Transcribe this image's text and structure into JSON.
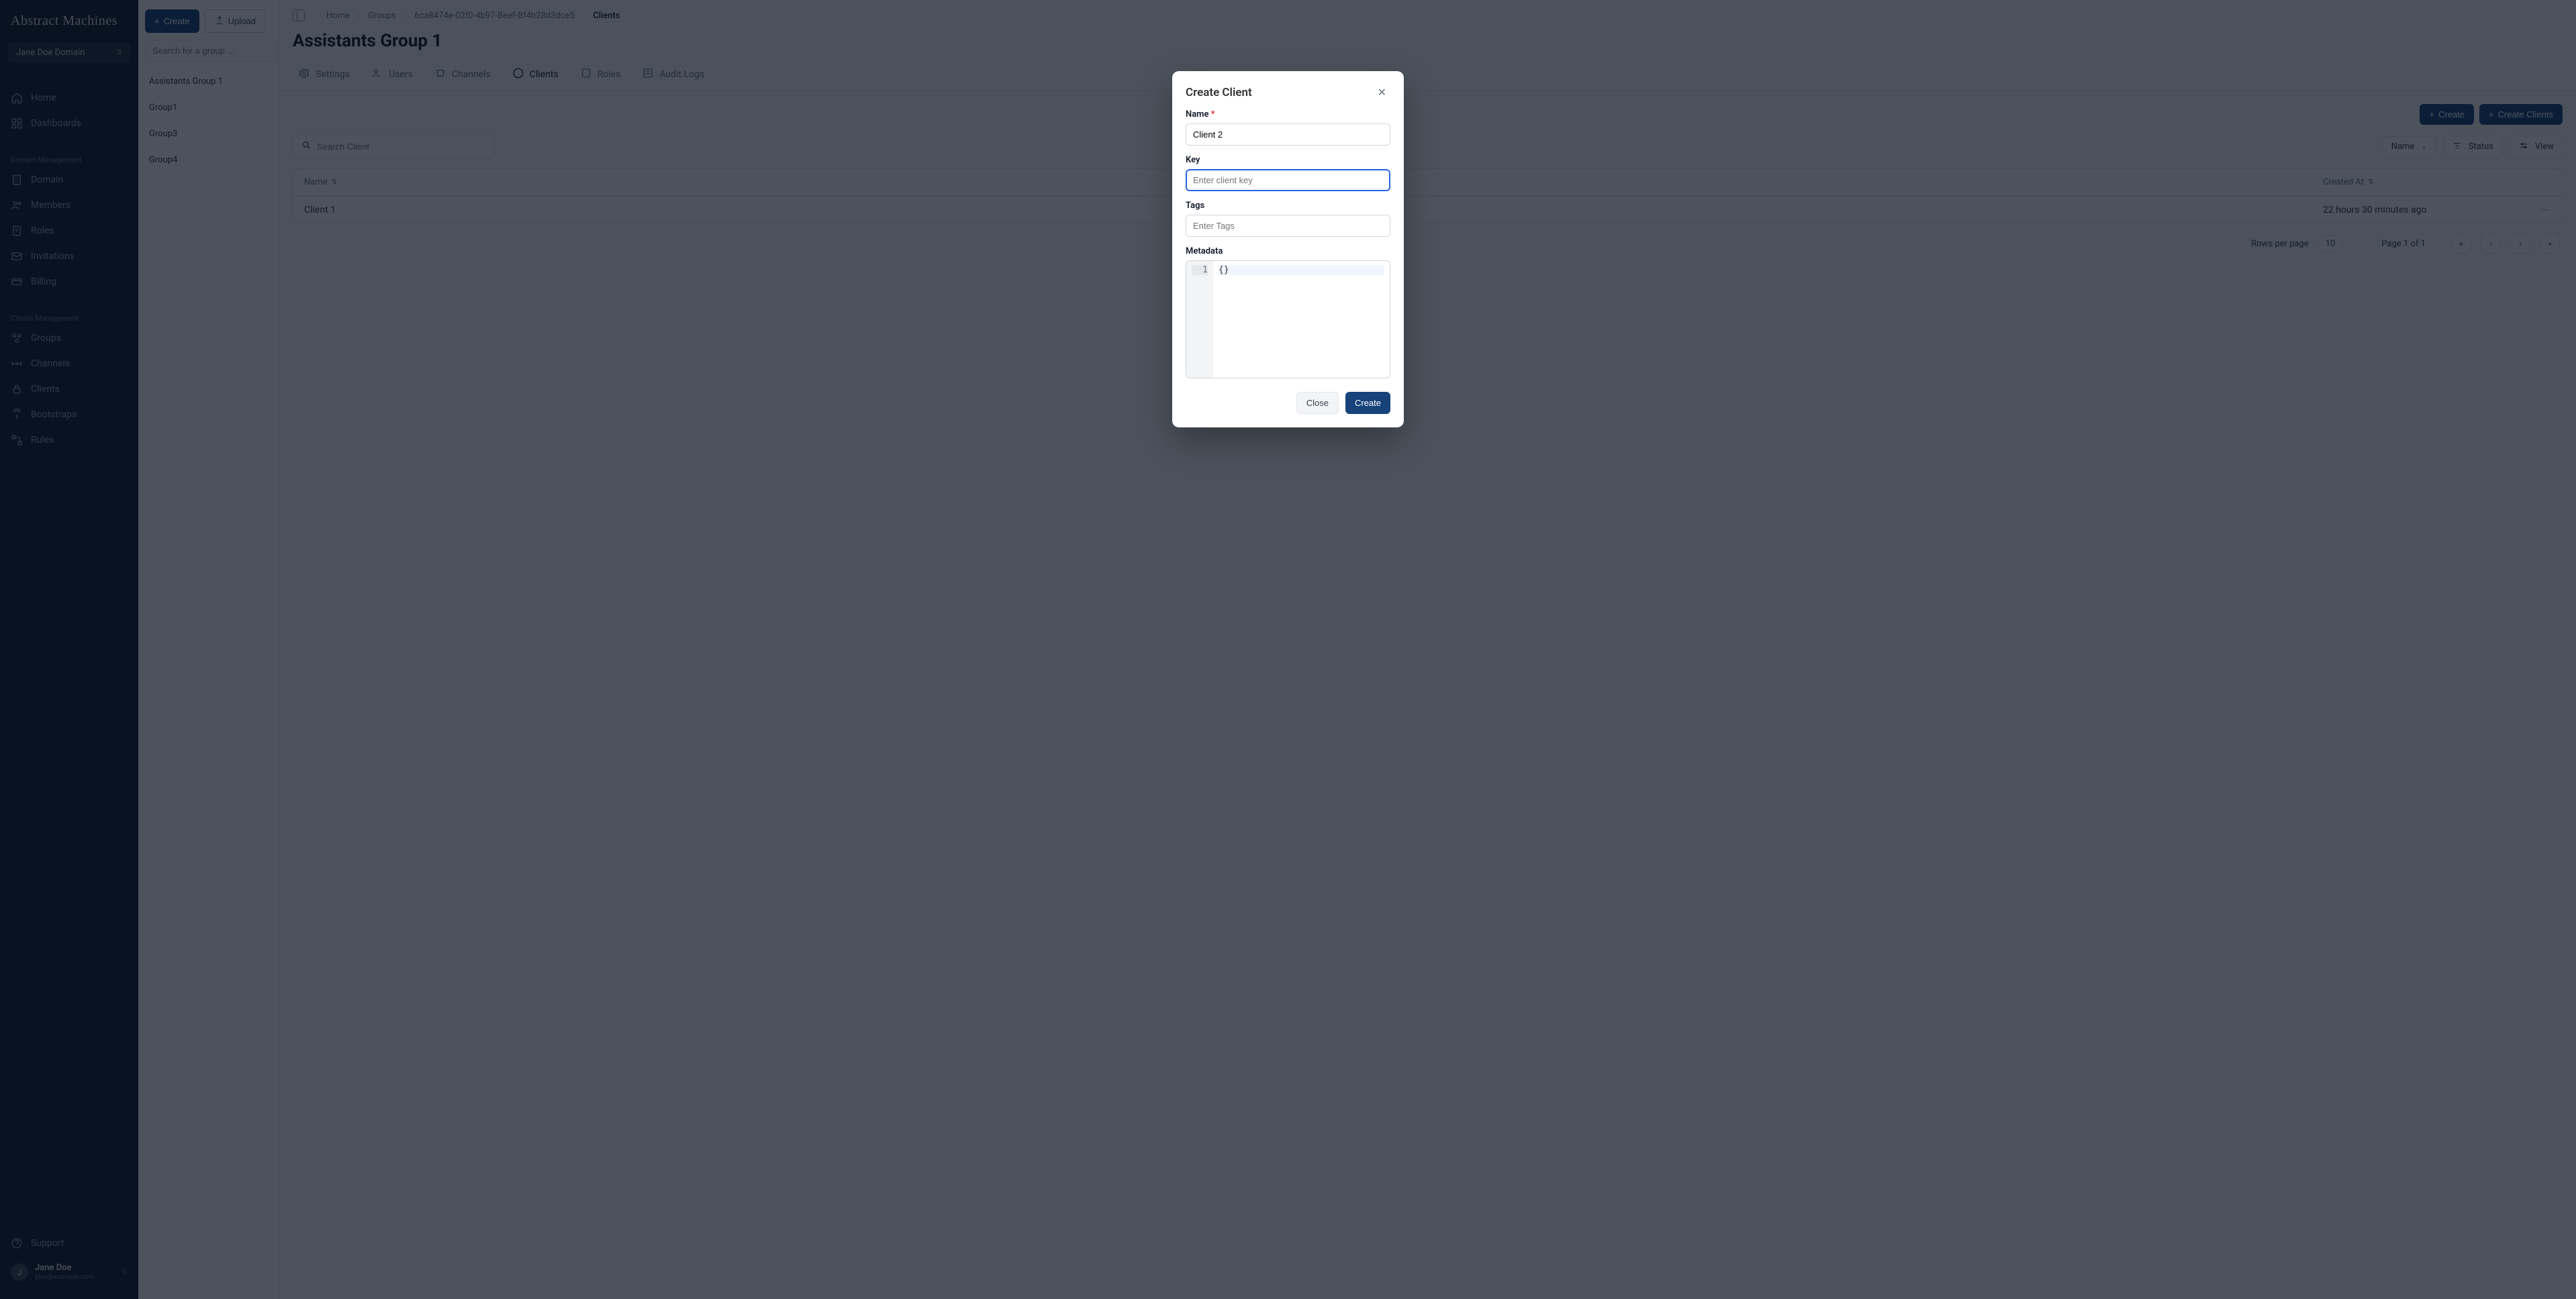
{
  "brand": "Abstract Machines",
  "domainSelector": {
    "label": "Jane Doe Domain"
  },
  "nav": {
    "home": "Home",
    "dashboards": "Dashboards",
    "section1": "Domain Management",
    "domain": "Domain",
    "members": "Members",
    "roles": "Roles",
    "invitations": "Invitations",
    "billing": "Billing",
    "section2": "Clients Management",
    "groups": "Groups",
    "channels": "Channels",
    "clients": "Clients",
    "bootstraps": "Bootstraps",
    "rules": "Rules",
    "support": "Support"
  },
  "user": {
    "initial": "J",
    "name": "Jane Doe",
    "email": "jdoe@example.com"
  },
  "groupsPanel": {
    "createLabel": "Create",
    "uploadLabel": "Upload",
    "searchPlaceholder": "Search for a group ...",
    "items": [
      "Assistants Group 1",
      "Group1",
      "Group3",
      "Group4"
    ]
  },
  "breadcrumbs": [
    "Home",
    "Groups",
    "6ca8474e-02f0-4b97-Beef-Bf4b28d3dce5",
    "Clients"
  ],
  "pageTitle": "Assistants Group 1",
  "tabs": [
    "Settings",
    "Users",
    "Channels",
    "Clients",
    "Roles",
    "Audit Logs"
  ],
  "toolbar": {
    "searchPlaceholder": "Search Client",
    "createLabel": "Create",
    "createClientsLabel": "Create Clients",
    "sortField": "Name",
    "statusLabel": "Status",
    "viewLabel": "View"
  },
  "table": {
    "colName": "Name",
    "colCreated": "Created At",
    "rows": [
      {
        "name": "Client 1",
        "created": "22 hours 30 minutes ago"
      }
    ]
  },
  "pagination": {
    "rowsPerPageLabel": "Rows per page",
    "pageSize": "10",
    "pageText": "Page 1 of 1"
  },
  "modal": {
    "title": "Create Client",
    "nameLabel": "Name",
    "nameValue": "Client 2",
    "keyLabel": "Key",
    "keyPlaceholder": "Enter client key",
    "tagsLabel": "Tags",
    "tagsPlaceholder": "Enter Tags",
    "metadataLabel": "Metadata",
    "metadataLine": "1",
    "metadataContent": "{}",
    "closeLabel": "Close",
    "createLabel": "Create"
  }
}
